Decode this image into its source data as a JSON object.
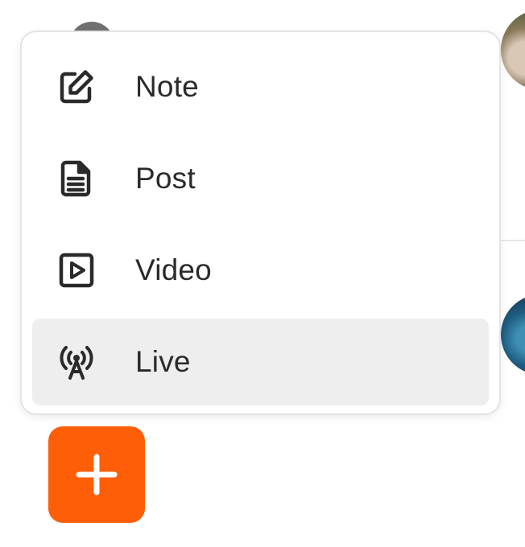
{
  "menu": {
    "items": [
      {
        "label": "Note",
        "icon": "edit-icon"
      },
      {
        "label": "Post",
        "icon": "document-icon"
      },
      {
        "label": "Video",
        "icon": "video-icon"
      },
      {
        "label": "Live",
        "icon": "broadcast-icon",
        "selected": true
      }
    ]
  },
  "fab": {
    "icon": "plus-icon"
  },
  "colors": {
    "accent": "#ff5e08",
    "selected_row": "#eeeeee",
    "text": "#2a2a2a",
    "menu_border": "#e4e4e4"
  }
}
